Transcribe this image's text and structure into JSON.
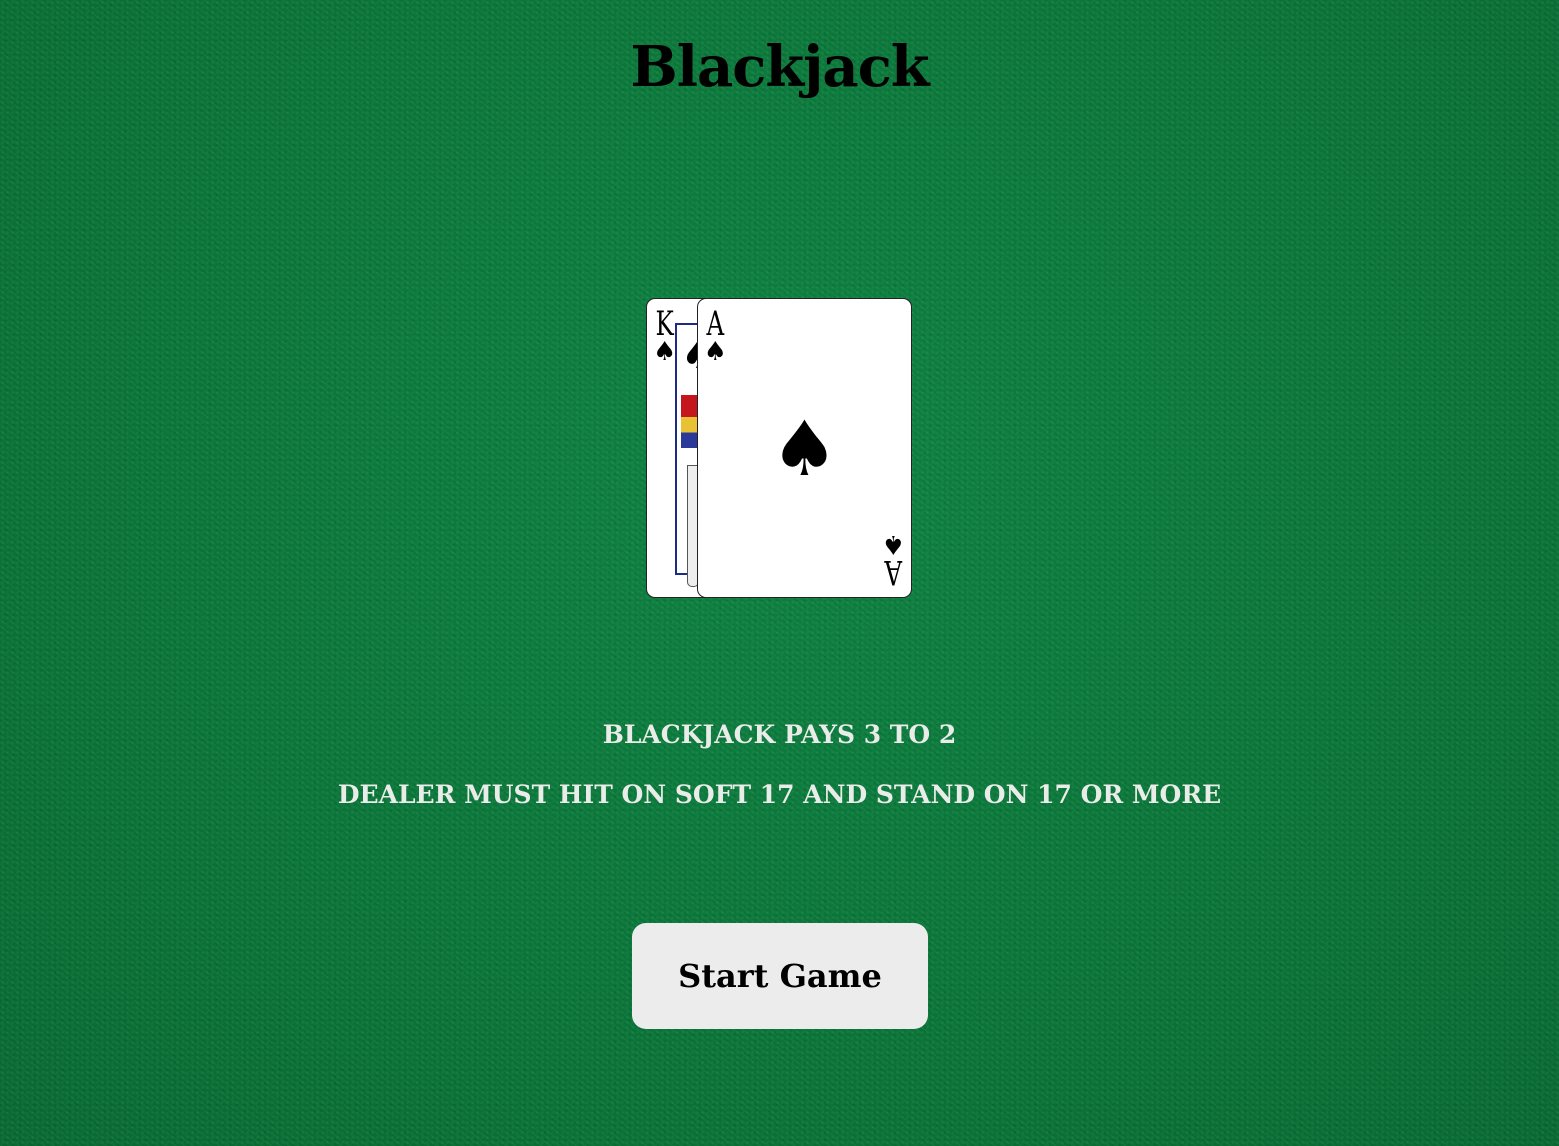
{
  "title": "Blackjack",
  "hand": {
    "cards": [
      {
        "rank": "K",
        "suit": "♠",
        "suit_name": "spades",
        "face": "king"
      },
      {
        "rank": "A",
        "suit": "♠",
        "suit_name": "spades",
        "face": "ace"
      }
    ]
  },
  "rules": {
    "payout": "BLACKJACK PAYS 3 TO 2",
    "dealer": "DEALER MUST HIT ON SOFT 17 AND STAND ON 17 OR MORE"
  },
  "buttons": {
    "start_label": "Start Game"
  },
  "colors": {
    "felt": "#0b7a3a",
    "button_bg": "#ececec",
    "info_text": "#e9ece8"
  }
}
